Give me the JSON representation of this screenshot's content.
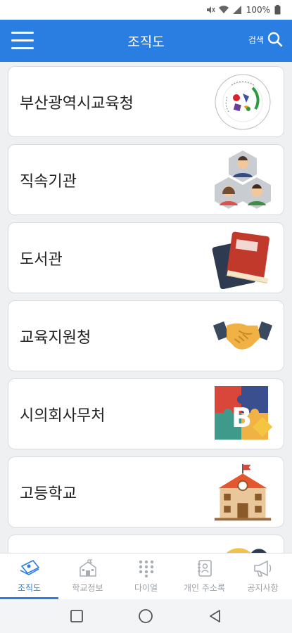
{
  "status": {
    "battery": "100%"
  },
  "header": {
    "title": "조직도",
    "search_label": "검색"
  },
  "cards": [
    {
      "label": "부산광역시교육청",
      "icon": "busan-education-office-emblem-icon"
    },
    {
      "label": "직속기관",
      "icon": "people-group-icon"
    },
    {
      "label": "도서관",
      "icon": "books-icon"
    },
    {
      "label": "교육지원청",
      "icon": "handshake-icon"
    },
    {
      "label": "시의회사무처",
      "icon": "puzzle-b-icon"
    },
    {
      "label": "고등학교",
      "icon": "school-building-icon"
    }
  ],
  "tabs": [
    {
      "label": "조직도",
      "icon": "org-chart-icon",
      "active": true
    },
    {
      "label": "학교정보",
      "icon": "school-icon",
      "active": false
    },
    {
      "label": "다이얼",
      "icon": "dialpad-icon",
      "active": false
    },
    {
      "label": "개인 주소록",
      "icon": "address-book-icon",
      "active": false
    },
    {
      "label": "공지사항",
      "icon": "megaphone-icon",
      "active": false
    }
  ],
  "colors": {
    "primary": "#2a7de1",
    "inactive": "#9aa0a6"
  }
}
